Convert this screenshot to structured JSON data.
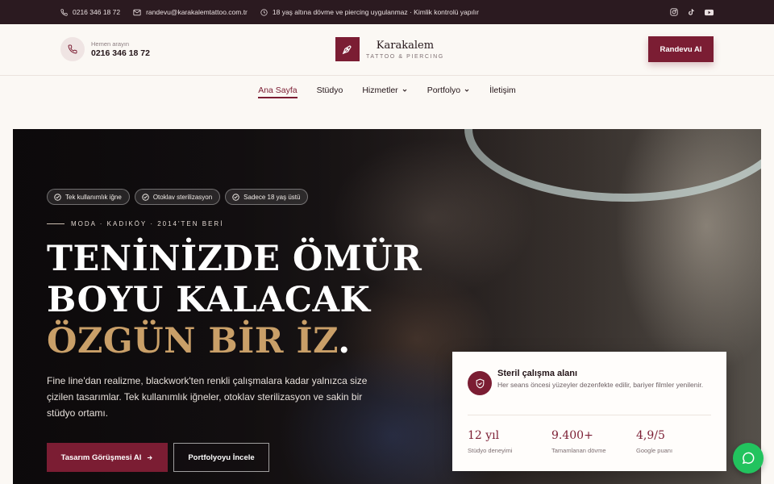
{
  "topbar": {
    "phone": "0216 346 18 72",
    "email": "randevu@karakalemtattoo.com.tr",
    "notice": "18 yaş altına dövme ve piercing uygulanmaz · Kimlik kontrolü yapılır",
    "socials": [
      "instagram-icon",
      "tiktok-icon",
      "youtube-icon"
    ]
  },
  "header": {
    "call_label": "Hemen arayın",
    "call_number": "0216 346 18 72",
    "brand_name": "Karakalem",
    "brand_tagline": "TATTOO & PIERCING",
    "cta_label": "Randevu Al"
  },
  "nav": {
    "items": [
      {
        "label": "Ana Sayfa",
        "active": true
      },
      {
        "label": "Stüdyo"
      },
      {
        "label": "Hizmetler",
        "dropdown": true
      },
      {
        "label": "Portfolyo",
        "dropdown": true
      },
      {
        "label": "İletişim"
      }
    ]
  },
  "hero": {
    "badges": [
      "Tek kullanımlık iğne",
      "Otoklav sterilizasyon",
      "Sadece 18 yaş üstü"
    ],
    "eyebrow": "MODA · KADIKÖY · 2014'TEN BERİ",
    "title_line1": "TENİNİZDE ÖMÜR",
    "title_line2": "BOYU KALACAK",
    "title_highlight": "ÖZGÜN BİR İZ",
    "title_dot": ".",
    "lead": "Fine line'dan realizme, blackwork'ten renkli çalışmalara kadar yalnızca size çizilen tasarımlar. Tek kullanımlık iğneler, otoklav sterilizasyon ve sakin bir stüdyo ortamı.",
    "primary_button": "Tasarım Görüşmesi Al",
    "secondary_button": "Portfolyoyu İncele"
  },
  "info_card": {
    "title": "Steril çalışma alanı",
    "description": "Her seans öncesi yüzeyler dezenfekte edilir, bariyer filmler yenilenir.",
    "stats": [
      {
        "value": "12 yıl",
        "label": "Stüdyo deneyimi"
      },
      {
        "value": "9.400+",
        "label": "Tamamlanan dövme"
      },
      {
        "value": "4,9/5",
        "label": "Google puanı"
      }
    ]
  },
  "colors": {
    "brand": "#7b1d33",
    "gold": "#c99f68",
    "topbar": "#2b1a20",
    "whatsapp": "#22c35e"
  }
}
